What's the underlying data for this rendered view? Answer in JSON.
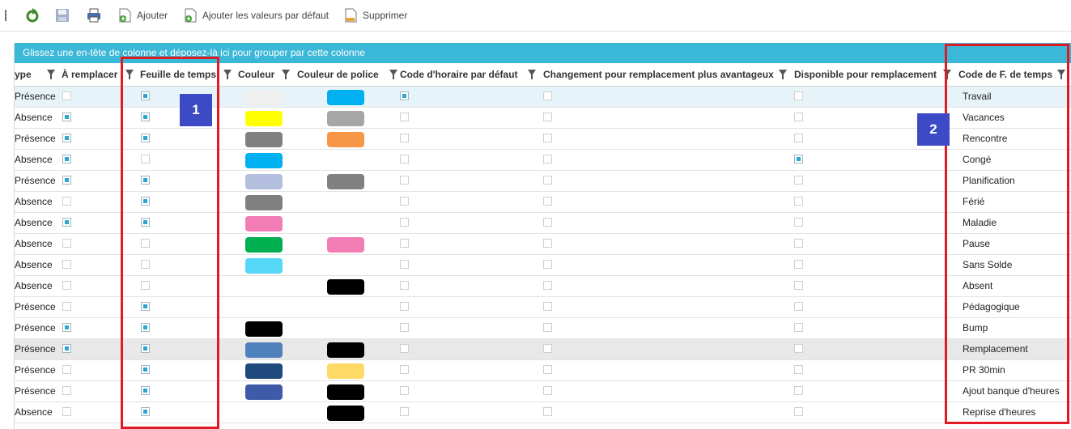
{
  "toolbar": {
    "refresh_label": "",
    "save_label": "",
    "print_label": "",
    "add_label": "Ajouter",
    "add_defaults_label": "Ajouter les valeurs par défaut",
    "delete_label": "Supprimer"
  },
  "grid": {
    "group_hint": "Glissez une en-tête de colonne et déposez-là ici pour grouper par cette colonne",
    "columns": [
      {
        "label": "ype"
      },
      {
        "label": "À remplacer"
      },
      {
        "label": "Feuille de temps"
      },
      {
        "label": "Couleur"
      },
      {
        "label": "Couleur de police"
      },
      {
        "label": "Code d'horaire par défaut"
      },
      {
        "label": "Changement pour remplacement plus avantageux"
      },
      {
        "label": "Disponible pour remplacement"
      },
      {
        "label": "Code de F. de temps"
      }
    ],
    "rows": [
      {
        "type": "Présence",
        "replace": false,
        "timesheet": true,
        "color": "#efefef",
        "font_color": "#00b0f0",
        "default_code": true,
        "better": false,
        "available": false,
        "code": "Travail",
        "state": "selected"
      },
      {
        "type": "Absence",
        "replace": true,
        "timesheet": true,
        "color": "#ffff00",
        "font_color": "#a6a6a6",
        "default_code": false,
        "better": false,
        "available": false,
        "code": "Vacances",
        "state": ""
      },
      {
        "type": "Présence",
        "replace": true,
        "timesheet": true,
        "color": "#808080",
        "font_color": "#f79646",
        "default_code": false,
        "better": false,
        "available": false,
        "code": "Rencontre",
        "state": ""
      },
      {
        "type": "Absence",
        "replace": true,
        "timesheet": false,
        "color": "#00b0f0",
        "font_color": "",
        "default_code": false,
        "better": false,
        "available": true,
        "code": "Congé",
        "state": ""
      },
      {
        "type": "Présence",
        "replace": true,
        "timesheet": true,
        "color": "#b4bfe0",
        "font_color": "#808080",
        "default_code": false,
        "better": false,
        "available": false,
        "code": "Planification",
        "state": ""
      },
      {
        "type": "Absence",
        "replace": false,
        "timesheet": true,
        "color": "#808080",
        "font_color": "",
        "default_code": false,
        "better": false,
        "available": false,
        "code": "Férié",
        "state": ""
      },
      {
        "type": "Absence",
        "replace": true,
        "timesheet": true,
        "color": "#f27cb4",
        "font_color": "",
        "default_code": false,
        "better": false,
        "available": false,
        "code": "Maladie",
        "state": ""
      },
      {
        "type": "Absence",
        "replace": false,
        "timesheet": false,
        "color": "#00b050",
        "font_color": "#f27cb4",
        "default_code": false,
        "better": false,
        "available": false,
        "code": "Pause",
        "state": ""
      },
      {
        "type": "Absence",
        "replace": false,
        "timesheet": false,
        "color": "#55d8f7",
        "font_color": "",
        "default_code": false,
        "better": false,
        "available": false,
        "code": "Sans Solde",
        "state": ""
      },
      {
        "type": "Absence",
        "replace": false,
        "timesheet": false,
        "color": "",
        "font_color": "#000000",
        "default_code": false,
        "better": false,
        "available": false,
        "code": "Absent",
        "state": ""
      },
      {
        "type": "Présence",
        "replace": false,
        "timesheet": true,
        "color": "",
        "font_color": "",
        "default_code": false,
        "better": false,
        "available": false,
        "code": "Pédagogique",
        "state": ""
      },
      {
        "type": "Présence",
        "replace": true,
        "timesheet": true,
        "color": "#000000",
        "font_color": "",
        "default_code": false,
        "better": false,
        "available": false,
        "code": "Bump",
        "state": ""
      },
      {
        "type": "Présence",
        "replace": true,
        "timesheet": true,
        "color": "#4f81bd",
        "font_color": "#000000",
        "default_code": false,
        "better": false,
        "available": false,
        "code": "Remplacement",
        "state": "hover"
      },
      {
        "type": "Présence",
        "replace": false,
        "timesheet": true,
        "color": "#1f497d",
        "font_color": "#ffd966",
        "default_code": false,
        "better": false,
        "available": false,
        "code": "PR 30min",
        "state": ""
      },
      {
        "type": "Présence",
        "replace": false,
        "timesheet": true,
        "color": "#3f5aa8",
        "font_color": "#000000",
        "default_code": false,
        "better": false,
        "available": false,
        "code": "Ajout banque d'heures",
        "state": ""
      },
      {
        "type": "Absence",
        "replace": false,
        "timesheet": true,
        "color": "",
        "font_color": "#000000",
        "default_code": false,
        "better": false,
        "available": false,
        "code": "Reprise d'heures",
        "state": ""
      }
    ]
  },
  "annotations": {
    "badge_1": "1",
    "badge_2": "2",
    "box_color": "#e01b24",
    "badge_color": "#3c4ac6"
  },
  "colors": {
    "accent": "#3bb7d7",
    "check": "#2aa6d4"
  }
}
